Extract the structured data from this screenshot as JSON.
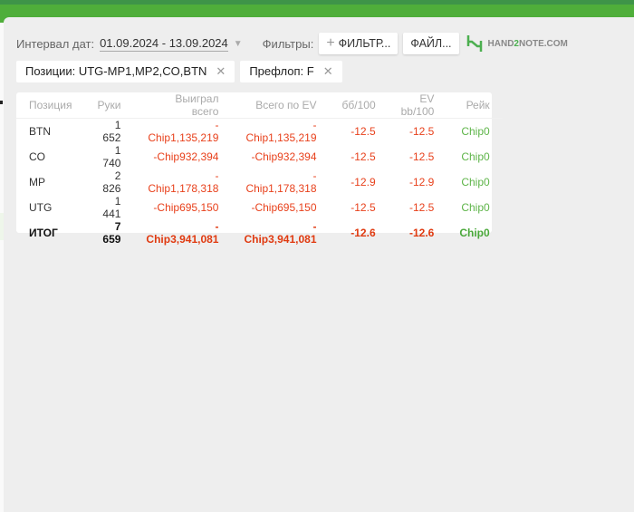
{
  "filters": {
    "date_label": "Интервал дат:",
    "date_value": "01.09.2024 - 13.09.2024",
    "filters_label": "Фильтры:",
    "filter_button": "ФИЛЬТР...",
    "file_button": "ФАЙЛ...",
    "logo_text": "HAND2NOTE.COM"
  },
  "chips": [
    {
      "label": "Позиции: UTG-MP1,MP2,CO,BTN"
    },
    {
      "label": "Префлоп: F"
    }
  ],
  "table": {
    "headers": [
      "Позиция",
      "Руки",
      "Выиграл всего",
      "Всего по EV",
      "бб/100",
      "EV bb/100",
      "Рейк"
    ],
    "rows": [
      [
        "BTN",
        "1 652",
        "-Chip1,135,219",
        "-Chip1,135,219",
        "-12.5",
        "-12.5",
        "Chip0"
      ],
      [
        "CO",
        "1 740",
        "-Chip932,394",
        "-Chip932,394",
        "-12.5",
        "-12.5",
        "Chip0"
      ],
      [
        "MP",
        "2 826",
        "-Chip1,178,318",
        "-Chip1,178,318",
        "-12.9",
        "-12.9",
        "Chip0"
      ],
      [
        "UTG",
        "1 441",
        "-Chip695,150",
        "-Chip695,150",
        "-12.5",
        "-12.5",
        "Chip0"
      ]
    ],
    "total": [
      "ИТОГ",
      "7 659",
      "-Chip3,941,081",
      "-Chip3,941,081",
      "-12.6",
      "-12.6",
      "Chip0"
    ]
  },
  "colors": {
    "negative": "#e8411c",
    "positive": "#5fb54a",
    "brand": "#4fae3a"
  }
}
